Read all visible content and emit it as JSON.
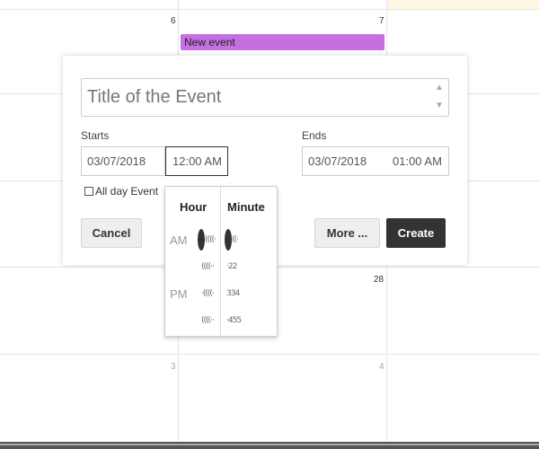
{
  "calendar": {
    "day_numbers": [
      "6",
      "7",
      "28",
      "3",
      "4"
    ],
    "event_chip_label": "New event",
    "event_color": "#c56fe0"
  },
  "popup": {
    "title_placeholder": "Title of the Event",
    "starts_label": "Starts",
    "ends_label": "Ends",
    "start_date": "03/07/2018",
    "start_time": "12:00 AM",
    "end_date": "03/07/2018",
    "end_time": "01:00 AM",
    "all_day_label": "All day Event",
    "cancel_label": "Cancel",
    "more_label": "More ...",
    "create_label": "Create"
  },
  "time_picker": {
    "hour_header": "Hour",
    "minute_header": "Minute",
    "am_label": "AM",
    "pm_label": "PM"
  }
}
